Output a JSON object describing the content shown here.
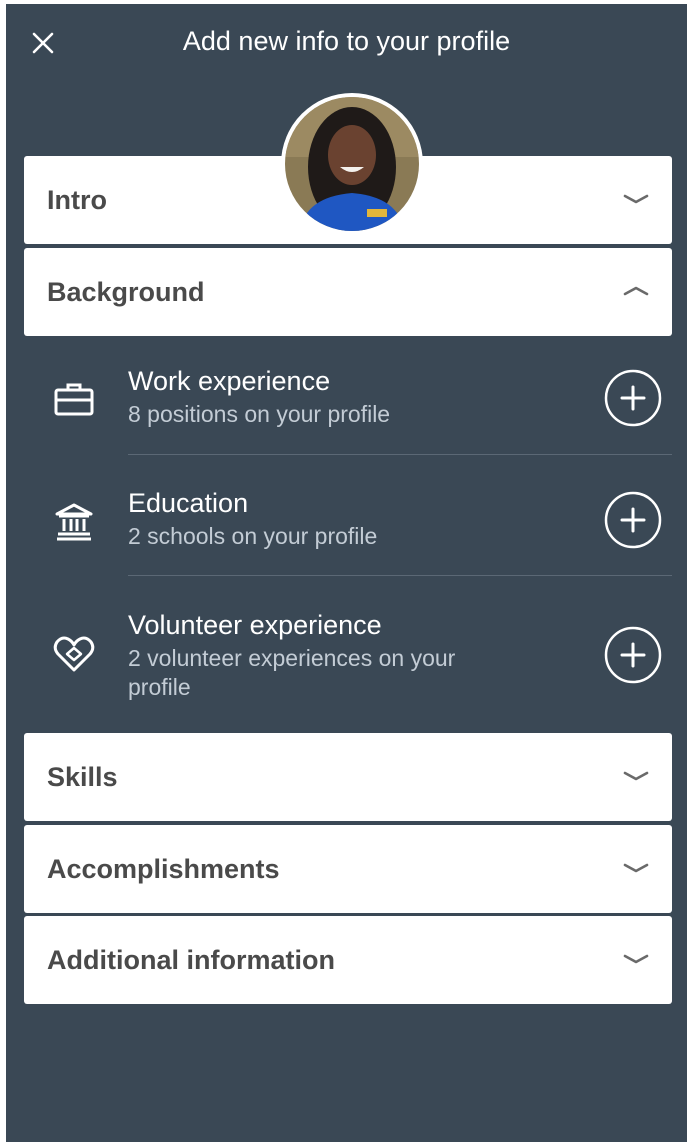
{
  "header": {
    "title": "Add new info to your profile"
  },
  "avatar": {
    "alt": "Profile photo"
  },
  "sections": {
    "intro": "Intro",
    "background": "Background",
    "skills": "Skills",
    "accomplishments": "Accomplishments",
    "additional": "Additional information"
  },
  "background_items": [
    {
      "title": "Work experience",
      "subtitle": "8 positions on your profile",
      "icon": "briefcase-icon"
    },
    {
      "title": "Education",
      "subtitle": "2 schools on your profile",
      "icon": "school-icon"
    },
    {
      "title": "Volunteer experience",
      "subtitle": "2 volunteer experiences on your profile",
      "icon": "heart-icon"
    }
  ],
  "colors": {
    "panel": "#3a4855",
    "card": "#ffffff",
    "text_dark": "#4a4a4a",
    "subtext": "#c3ccd5"
  }
}
